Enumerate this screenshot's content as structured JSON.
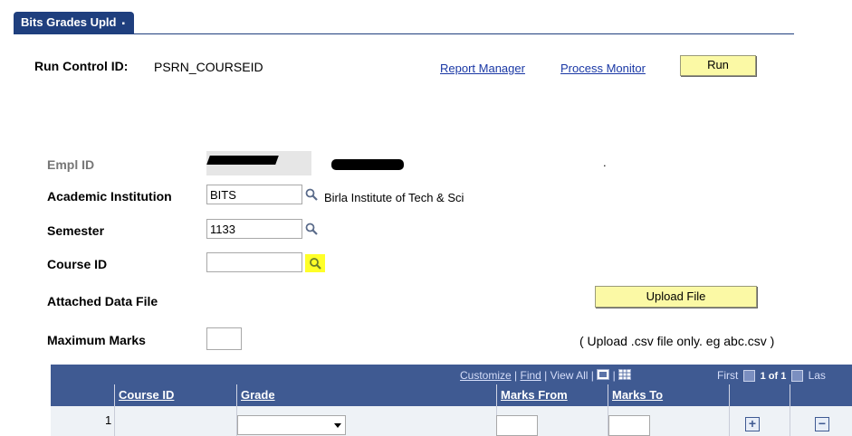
{
  "tab": {
    "label": "Bits Grades Upld",
    "dot": "▪"
  },
  "run_control": {
    "label": "Run Control ID:",
    "value": "PSRN_COURSEID"
  },
  "links": {
    "report_manager": "Report Manager",
    "process_monitor": "Process Monitor"
  },
  "buttons": {
    "run": "Run",
    "upload_file": "Upload File"
  },
  "form": {
    "empl_id": {
      "label": "Empl ID",
      "trailing": "."
    },
    "academic_institution": {
      "label": "Academic Institution",
      "value": "BITS",
      "description": "Birla Institute of Tech & Sci"
    },
    "semester": {
      "label": "Semester",
      "value": "1133"
    },
    "course_id": {
      "label": "Course ID",
      "value": ""
    },
    "attached_data_file": {
      "label": "Attached Data File"
    },
    "maximum_marks": {
      "label": "Maximum Marks",
      "value": ""
    },
    "upload_hint": "( Upload .csv file only. eg abc.csv )"
  },
  "grid": {
    "toolbar": {
      "customize": "Customize",
      "sep1": " | ",
      "find": "Find",
      "sep2": " | ",
      "view_all": "View All",
      "sep3": " | ",
      "first": "First",
      "count": "1 of 1",
      "last": "Las"
    },
    "columns": [
      "Course ID",
      "Grade",
      "Marks From",
      "Marks To"
    ],
    "rows": [
      {
        "num": "1",
        "course_id": "",
        "grade": "",
        "marks_from": "",
        "marks_to": ""
      }
    ],
    "add_symbol": "+",
    "remove_symbol": "−"
  },
  "colors": {
    "tab": "#1f3f7e",
    "grid_header": "#3f5a92",
    "button": "#fbf9a5",
    "link": "#1a38a5",
    "lookup_highlight": "#ffff28"
  }
}
